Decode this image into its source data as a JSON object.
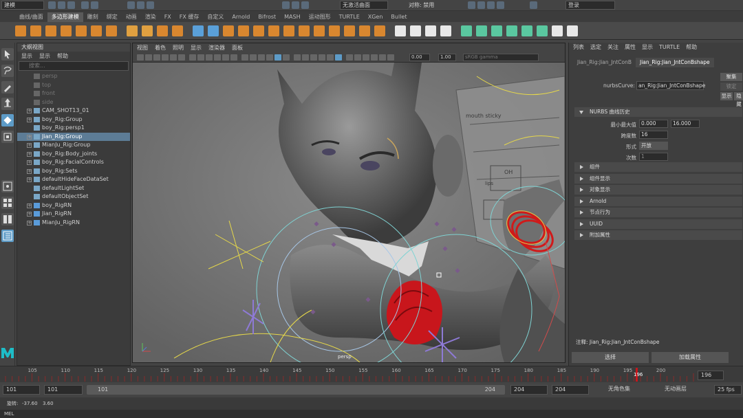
{
  "status_line": {
    "mode": "建模",
    "no_live_surface": "无激活曲面",
    "symmetry_label": "对称: 禁用",
    "login": "登录"
  },
  "shelf_tabs": [
    "曲线/曲面",
    "多边形建模",
    "雕刻",
    "绑定",
    "动画",
    "渲染",
    "FX",
    "FX 缓存",
    "自定义",
    "Arnold",
    "Bifrost",
    "MASH",
    "运动图形",
    "TURTLE",
    "XGen",
    "Bullet"
  ],
  "shelf_active": 1,
  "outliner": {
    "title": "大纲视图",
    "menu": [
      "显示",
      "显示",
      "帮助"
    ],
    "search_placeholder": "搜索...",
    "items": [
      {
        "label": "persp",
        "dim": true,
        "expander": false
      },
      {
        "label": "top",
        "dim": true,
        "expander": false
      },
      {
        "label": "front",
        "dim": true,
        "expander": false
      },
      {
        "label": "side",
        "dim": true,
        "expander": false
      },
      {
        "label": "CAM_SHOT13_01",
        "dim": false,
        "expander": true
      },
      {
        "label": "boy_Rig:Group",
        "dim": false,
        "expander": true
      },
      {
        "label": "boy_Rig:persp1",
        "dim": false,
        "expander": false
      },
      {
        "label": "Jian_Rig:Group",
        "dim": false,
        "expander": true,
        "selected": true
      },
      {
        "label": "MianJu_Rig:Group",
        "dim": false,
        "expander": true
      },
      {
        "label": "boy_Rig:Body_joints",
        "dim": false,
        "expander": true
      },
      {
        "label": "boy_Rig:FacialControls",
        "dim": false,
        "expander": true
      },
      {
        "label": "boy_Rig:Sets",
        "dim": false,
        "expander": true
      },
      {
        "label": "defaultHideFaceDataSet",
        "dim": false,
        "expander": true
      },
      {
        "label": "defaultLightSet",
        "dim": false,
        "expander": false
      },
      {
        "label": "defaultObjectSet",
        "dim": false,
        "expander": false
      },
      {
        "label": "boy_RigRN",
        "dim": false,
        "expander": true
      },
      {
        "label": "Jian_RigRN",
        "dim": false,
        "expander": true
      },
      {
        "label": "MianJu_RigRN",
        "dim": false,
        "expander": true
      }
    ]
  },
  "viewport": {
    "menu": [
      "视图",
      "着色",
      "照明",
      "显示",
      "渲染器",
      "面板"
    ],
    "exposure": "0.00",
    "gamma": "1.00",
    "colorspace": "sRGB gamma",
    "camera": "persp",
    "mouth_label": "mouth sticky",
    "oh_label": "OH",
    "lips_label": "lips"
  },
  "attribute_editor": {
    "menu": [
      "列表",
      "选定",
      "关注",
      "属性",
      "显示",
      "TURTLE",
      "帮助"
    ],
    "tabs": [
      "Jian_Rig:Jian_JntConB",
      "Jian_Rig:Jian_JntConBshape"
    ],
    "active_tab": 1,
    "node_label": "nurbsCurve:",
    "node_value": "an_Rig:Jian_JntConBshape",
    "side_buttons": [
      "聚集",
      "锁定",
      "显示",
      "隐藏"
    ],
    "history_section": "NURBS 曲线历史",
    "fields": {
      "min_max_label": "最小最大值",
      "min_value": "0.000",
      "max_value": "16.000",
      "spans_label": "跨度数",
      "spans_value": "16",
      "form_label": "形式",
      "form_value": "开放",
      "degree_label": "次数",
      "degree_value": "1"
    },
    "sections": [
      "组件",
      "组件显示",
      "对象显示",
      "Arnold",
      "节点行为",
      "UUID",
      "附加属性"
    ],
    "notes": "注释: Jian_Rig:Jian_JntConBshape",
    "select_btn": "选择",
    "load_attr_btn": "加载属性"
  },
  "timeslider": {
    "ticks": [
      "105",
      "110",
      "115",
      "120",
      "125",
      "130",
      "135",
      "140",
      "145",
      "150",
      "155",
      "160",
      "165",
      "170",
      "175",
      "180",
      "185",
      "190",
      "195",
      "200"
    ],
    "current": "196",
    "current_field": "196"
  },
  "range": {
    "start": "101",
    "start2": "101",
    "slider_start": "101",
    "slider_end": "204",
    "end": "204",
    "end2": "204",
    "character_set": "无角色集",
    "anim_layer": "无动画层",
    "fps": "25 fps"
  },
  "helpline": {
    "label": "旋转:",
    "x": "-37.60",
    "y": "3.60"
  },
  "mel_label": "MEL",
  "colors": {
    "accent": "#5d9bc7",
    "selection": "#5d7c96",
    "bracelet_red": "#c8161c",
    "control_yellow": "#e6d84a",
    "control_cyan": "#7fd3d3"
  }
}
